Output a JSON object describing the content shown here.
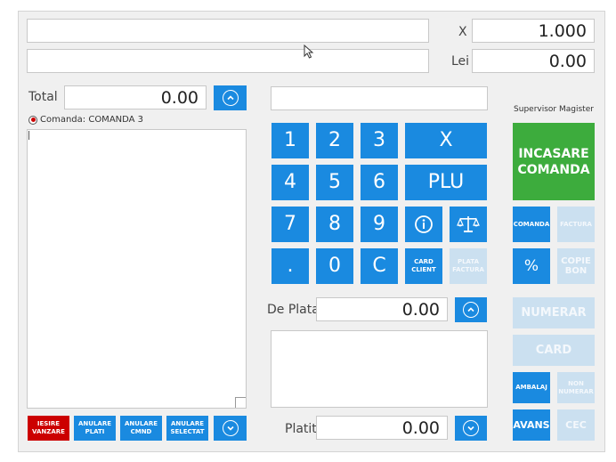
{
  "top": {
    "field1_value": "",
    "field2_value": "",
    "x_label": "X",
    "x_value": "1.000",
    "lei_label": "Lei",
    "lei_value": "0.00"
  },
  "left": {
    "total_label": "Total",
    "total_value": "0.00",
    "order_label": "Comanda: COMANDA 3"
  },
  "bottom_buttons": {
    "iesire_vanzare": "IESIRE\nVANZARE",
    "anulare_plati": "ANULARE\nPLATI",
    "anulare_cmnd": "ANULARE\nCMND",
    "anulare_selectat": "ANULARE\nSELECTAT"
  },
  "keypad": {
    "k1": "1",
    "k2": "2",
    "k3": "3",
    "kx": "X",
    "k4": "4",
    "k5": "5",
    "k6": "6",
    "kplu": "PLU",
    "k7": "7",
    "k8": "8",
    "k9": "9",
    "kdot": ".",
    "k0": "0",
    "kc": "C",
    "card_client": "CARD\nCLIENT",
    "plata_factura": "PLATA\nFACTURA"
  },
  "payment": {
    "de_plata_label": "De Plata",
    "de_plata_value": "0.00",
    "platit_label": "Platit",
    "platit_value": "0.00"
  },
  "right": {
    "supervisor": "Supervisor Magister",
    "incasare": "INCASARE\nCOMANDA",
    "comanda": "COMANDA",
    "factura": "FACTURA",
    "percent": "%",
    "copie_bon": "COPIE\nBON",
    "numerar": "NUMERAR",
    "card": "CARD",
    "ambalaj": "AMBALAJ",
    "non_numerar": "NON\nNUMERAR",
    "avans": "AVANS",
    "cec": "CEC"
  },
  "colors": {
    "blue": "#1a8ae0",
    "disabled": "#cbe0f0",
    "red": "#cc0000",
    "green": "#3dac3d"
  }
}
